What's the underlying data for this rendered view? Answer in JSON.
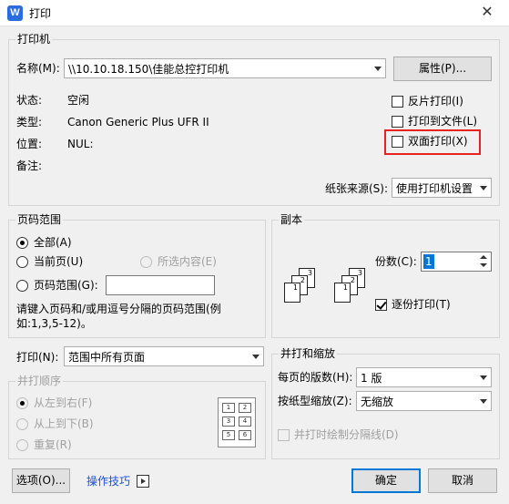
{
  "window": {
    "icon": "W",
    "title": "打印",
    "close": "✕"
  },
  "printer": {
    "group_label": "打印机",
    "name_label": "名称(M):",
    "name_value": "\\\\10.10.18.150\\佳能总控打印机",
    "properties_button": "属性(P)...",
    "status_label": "状态:",
    "status_value": "空闲",
    "type_label": "类型:",
    "type_value": "Canon Generic Plus UFR II",
    "where_label": "位置:",
    "where_value": "NUL:",
    "comment_label": "备注:",
    "reverse_print": "反片打印(I)",
    "print_to_file": "打印到文件(L)",
    "duplex": "双面打印(X)",
    "paper_source_label": "纸张来源(S):",
    "paper_source_value": "使用打印机设置"
  },
  "page_range": {
    "group_label": "页码范围",
    "all": "全部(A)",
    "current": "当前页(U)",
    "selection": "所选内容(E)",
    "pages": "页码范围(G):",
    "pages_value": "",
    "hint": "请键入页码和/或用逗号分隔的页码范围(例如:1,3,5-12)。"
  },
  "copies": {
    "group_label": "副本",
    "count_label": "份数(C):",
    "count_value": "1",
    "collate": "逐份打印(T)"
  },
  "print_what": {
    "label": "打印(N):",
    "value": "范围中所有页面"
  },
  "order": {
    "group_label": "并打顺序",
    "ltr": "从左到右(F)",
    "ttb": "从上到下(B)",
    "repeat": "重复(R)",
    "grid": [
      "1",
      "2",
      "3",
      "4",
      "5",
      "6"
    ]
  },
  "zoom": {
    "group_label": "并打和缩放",
    "pages_per_sheet_label": "每页的版数(H):",
    "pages_per_sheet_value": "1 版",
    "scale_label": "按纸型缩放(Z):",
    "scale_value": "无缩放",
    "draw_lines": "并打时绘制分隔线(D)"
  },
  "footer": {
    "options": "选项(O)...",
    "tips": "操作技巧",
    "ok": "确定",
    "cancel": "取消"
  },
  "colors": {
    "highlight": "#e8231f",
    "link": "#1a4fd6",
    "default_border": "#0078d7"
  }
}
